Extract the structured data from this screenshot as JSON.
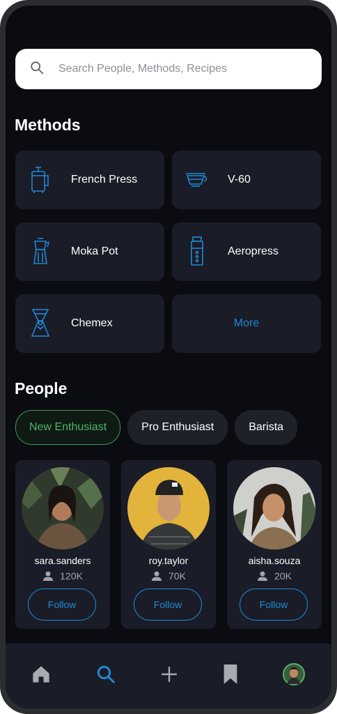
{
  "search": {
    "placeholder": "Search People, Methods, Recipes",
    "icon": "search-icon"
  },
  "methods": {
    "title": "Methods",
    "items": [
      {
        "label": "French Press",
        "icon": "french-press-icon"
      },
      {
        "label": "V-60",
        "icon": "v60-dripper-icon"
      },
      {
        "label": "Moka Pot",
        "icon": "moka-pot-icon"
      },
      {
        "label": "Aeropress",
        "icon": "aeropress-icon"
      },
      {
        "label": "Chemex",
        "icon": "chemex-icon"
      }
    ],
    "more_label": "More"
  },
  "people": {
    "title": "People",
    "filters": [
      "New Enthusiast",
      "Pro Enthusiast",
      "Barista"
    ],
    "active_filter": "New Enthusiast",
    "users": [
      {
        "username": "sara.sanders",
        "followers": "120K",
        "follow_label": "Follow"
      },
      {
        "username": "roy.taylor",
        "followers": "70K",
        "follow_label": "Follow"
      },
      {
        "username": "aisha.souza",
        "followers": "20K",
        "follow_label": "Follow"
      }
    ]
  },
  "bottom_nav": [
    "home-icon",
    "search-icon",
    "add-icon",
    "bookmark-icon",
    "profile-avatar"
  ],
  "colors": {
    "accent": "#1e8ad6",
    "active_chip": "#4bb56a",
    "background": "#0b0c11",
    "card": "#1a1c27"
  }
}
